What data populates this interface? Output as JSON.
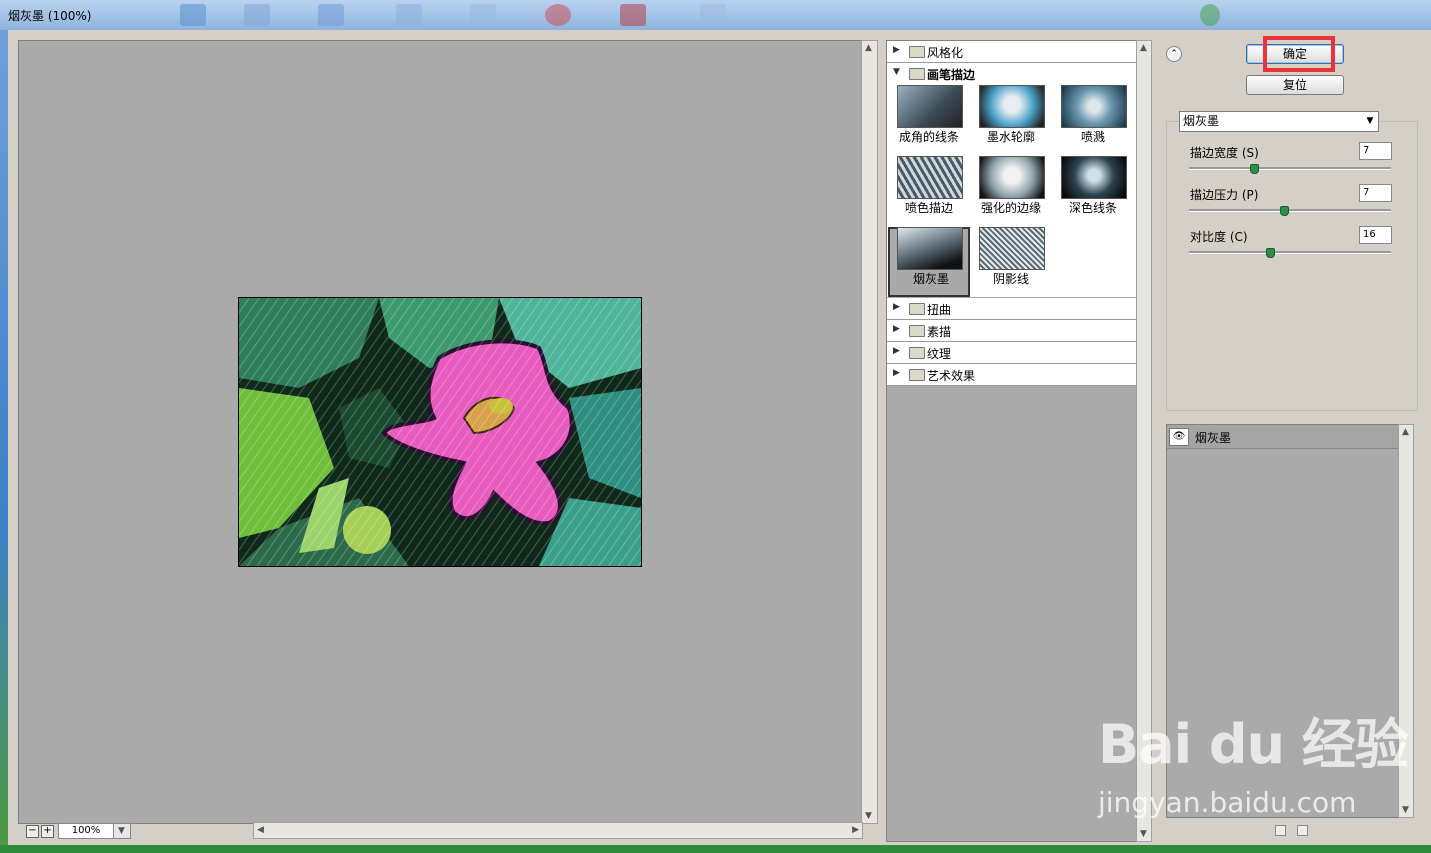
{
  "window": {
    "title": "烟灰墨 (100%)"
  },
  "preview": {
    "zoom": "100%"
  },
  "filters": {
    "categories_top": [
      {
        "label": "风格化",
        "expanded": false
      },
      {
        "label": "画笔描边",
        "expanded": true
      }
    ],
    "thumbnails": [
      "成角的线条",
      "墨水轮廓",
      "喷溅",
      "喷色描边",
      "强化的边缘",
      "深色线条",
      "烟灰墨",
      "阴影线"
    ],
    "selected": "烟灰墨",
    "categories_bottom": [
      "扭曲",
      "素描",
      "纹理",
      "艺术效果"
    ]
  },
  "buttons": {
    "ok": "确定",
    "reset": "复位"
  },
  "settings": {
    "filter_select": "烟灰墨",
    "params": [
      {
        "label": "描边宽度 (S)",
        "value": "7",
        "fraction": 0.32
      },
      {
        "label": "描边压力 (P)",
        "value": "7",
        "fraction": 0.47
      },
      {
        "label": "对比度 (C)",
        "value": "16",
        "fraction": 0.4
      }
    ]
  },
  "layers": {
    "items": [
      "烟灰墨"
    ]
  },
  "watermark": {
    "brand": "Bai du 经验",
    "url": "jingyan.baidu.com"
  },
  "colors": {
    "preview_bg": "#aaaaaa",
    "highlight": "#e8343a",
    "knob": "#2f8f4a"
  }
}
